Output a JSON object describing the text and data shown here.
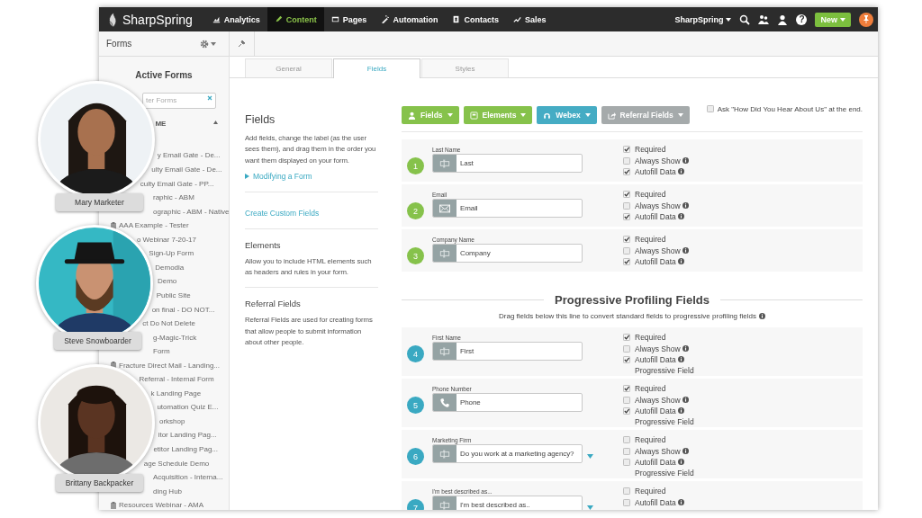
{
  "nav": {
    "brand": "SharpSpring",
    "items": [
      {
        "label": "Analytics",
        "selected": false
      },
      {
        "label": "Content",
        "selected": true
      },
      {
        "label": "Pages",
        "selected": false
      },
      {
        "label": "Automation",
        "selected": false
      },
      {
        "label": "Contacts",
        "selected": false
      },
      {
        "label": "Sales",
        "selected": false
      }
    ],
    "account": "SharpSpring",
    "help": "?",
    "new_button": "New"
  },
  "toolbar": {
    "title": "Forms"
  },
  "sidebar": {
    "title": "Active Forms",
    "filter_placeholder": "ter Forms",
    "column": "ME",
    "rows": [
      {
        "name": "y Email Gate - De...",
        "covered": true
      },
      {
        "name": "ulty Email Gate - De...",
        "covered": true
      },
      {
        "name": "culty Email Gate - PP...",
        "covered": true
      },
      {
        "name": "raphic - ABM",
        "covered": true
      },
      {
        "name": "ographic - ABM - Native",
        "covered": true
      },
      {
        "name": "AAA Example - Tester",
        "covered": false
      },
      {
        "name": "o Webinar 7-20-17",
        "covered": true
      },
      {
        "name": "Sign-Up Form",
        "covered": true
      },
      {
        "name": "Demodia",
        "covered": true
      },
      {
        "name": "Demo",
        "covered": true
      },
      {
        "name": "Public Site",
        "covered": true
      },
      {
        "name": "on final - DO NOT...",
        "covered": true
      },
      {
        "name": "ct Do Not Delete",
        "covered": true
      },
      {
        "name": "g-Magic-Trick",
        "covered": true
      },
      {
        "name": "Form",
        "covered": true
      },
      {
        "name": "Fracture Direct Mail - Landing...",
        "covered": false
      },
      {
        "name": "Referral - Internal Form",
        "covered": true
      },
      {
        "name": "k Landing Page",
        "covered": true
      },
      {
        "name": "utomation Quiz E...",
        "covered": true
      },
      {
        "name": "orkshop",
        "covered": true
      },
      {
        "name": "itor Landing Pag...",
        "covered": true
      },
      {
        "name": "etitor Landing Pag...",
        "covered": true
      },
      {
        "name": "age Schedule Demo",
        "covered": true
      },
      {
        "name": "Acquisition - Interna...",
        "covered": true
      },
      {
        "name": "ding Hub",
        "covered": true
      },
      {
        "name": "Resources Webinar - AMA",
        "covered": false
      }
    ]
  },
  "people": [
    {
      "name": "Mary Marketer"
    },
    {
      "name": "Steve Snowboarder"
    },
    {
      "name": "Brittany Backpacker"
    }
  ],
  "tabs": [
    {
      "label": "General",
      "selected": false
    },
    {
      "label": "Fields",
      "selected": true
    },
    {
      "label": "Styles",
      "selected": false
    }
  ],
  "help": [
    {
      "heading": "Fields",
      "text": "Add fields, change the label (as the user sees them), and drag them in the order you want them displayed on your form.",
      "link": "Modifying a Form"
    },
    {
      "link": "Create Custom Fields"
    },
    {
      "heading": "Elements",
      "text": "Allow you to include HTML elements such as headers and rules in your form."
    },
    {
      "heading": "Referral Fields",
      "text": "Referral Fields are used for creating forms that allow people to submit information about other people."
    }
  ],
  "add_buttons": [
    {
      "label": "Fields",
      "color": "#86c24b"
    },
    {
      "label": "Elements",
      "color": "#86c24b"
    },
    {
      "label": "Webex",
      "color": "#45acc4"
    },
    {
      "label": "Referral Fields",
      "color": "#a5aaab"
    }
  ],
  "ask_checkbox": {
    "label": "Ask \"How Did You Hear About Us\" at the end.",
    "checked": false
  },
  "standard_fields": [
    {
      "number": "1",
      "label": "Last Name",
      "value": "Last",
      "kind": "text",
      "dropdown": false,
      "options": [
        {
          "label": "Required",
          "checked": true,
          "info": false
        },
        {
          "label": "Always Show",
          "checked": false,
          "info": true
        },
        {
          "label": "Autofill Data",
          "checked": true,
          "info": true
        }
      ]
    },
    {
      "number": "2",
      "label": "Email",
      "value": "Email",
      "kind": "email",
      "dropdown": false,
      "options": [
        {
          "label": "Required",
          "checked": true,
          "info": false
        },
        {
          "label": "Always Show",
          "checked": false,
          "info": true
        },
        {
          "label": "Autofill Data",
          "checked": true,
          "info": true
        }
      ]
    },
    {
      "number": "3",
      "label": "Company Name",
      "value": "Company",
      "kind": "text",
      "dropdown": false,
      "options": [
        {
          "label": "Required",
          "checked": true,
          "info": false
        },
        {
          "label": "Always Show",
          "checked": false,
          "info": true
        },
        {
          "label": "Autofill Data",
          "checked": true,
          "info": true
        }
      ]
    }
  ],
  "progressive": {
    "title": "Progressive Profiling Fields",
    "subtitle": "Drag fields below this line to convert standard fields to progressive profiling fields",
    "fields": [
      {
        "number": "4",
        "label": "First Name",
        "value": "First",
        "kind": "text",
        "dropdown": false,
        "note": "Progressive Field",
        "options": [
          {
            "label": "Required",
            "checked": true,
            "info": false
          },
          {
            "label": "Always Show",
            "checked": false,
            "info": true
          },
          {
            "label": "Autofill Data",
            "checked": true,
            "info": true
          }
        ]
      },
      {
        "number": "5",
        "label": "Phone Number",
        "value": "Phone",
        "kind": "phone",
        "dropdown": false,
        "note": "Progressive Field",
        "options": [
          {
            "label": "Required",
            "checked": true,
            "info": false
          },
          {
            "label": "Always Show",
            "checked": false,
            "info": true
          },
          {
            "label": "Autofill Data",
            "checked": true,
            "info": true
          }
        ]
      },
      {
        "number": "6",
        "label": "Marketing Firm",
        "value": "Do you work at a marketing agency?",
        "kind": "text",
        "dropdown": true,
        "note": "Progressive Field",
        "options": [
          {
            "label": "Required",
            "checked": false,
            "info": false
          },
          {
            "label": "Always Show",
            "checked": false,
            "info": true
          },
          {
            "label": "Autofill Data",
            "checked": false,
            "info": true
          }
        ]
      },
      {
        "number": "7",
        "label": "I'm best described as...",
        "value": "I'm best described as..",
        "kind": "text",
        "dropdown": true,
        "options": [
          {
            "label": "Required",
            "checked": false,
            "info": false
          },
          {
            "label": "Autofill Data",
            "checked": false,
            "info": true
          }
        ]
      }
    ]
  }
}
